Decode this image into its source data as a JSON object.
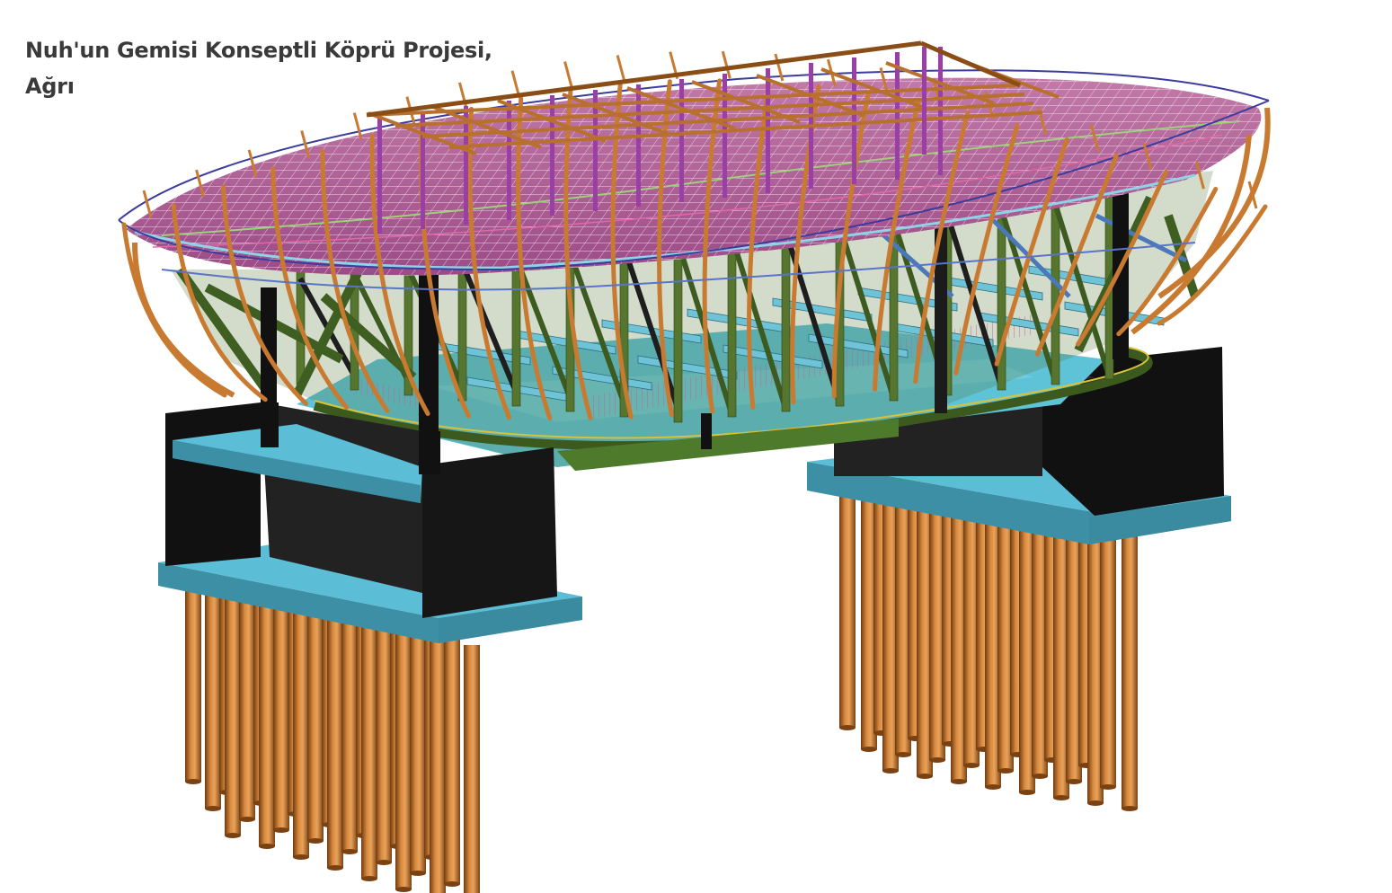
{
  "title": {
    "line1": "Nuh'un Gemisi Konseptli Köprü Projesi,",
    "line2": "Ağrı"
  },
  "colors": {
    "pile": "#c9782f",
    "pile_shade": "#7a4212",
    "pier_dark": "#1a1a1a",
    "cap_cyan": "#5bbed6",
    "cap_cyan_side": "#3d8fa5",
    "hull_rib": "#c87a30",
    "truss_green": "#56752f",
    "deck_magenta": "#b0508f",
    "grid_white": "#f2e6f0",
    "roof_beam": "#b8702e",
    "column_purple": "#9a3fa6",
    "cross_beam": "#6ec3d6"
  }
}
